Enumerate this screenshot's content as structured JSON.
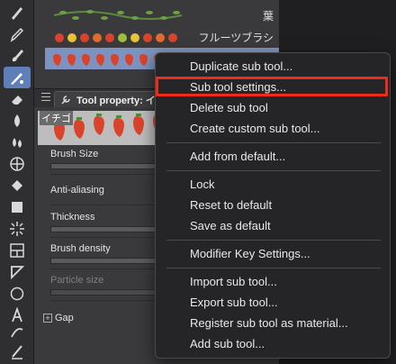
{
  "toolbar": {
    "tools": [
      {
        "icon": "pen-icon"
      },
      {
        "icon": "pencil-icon"
      },
      {
        "icon": "brush-icon"
      },
      {
        "icon": "decoration-icon",
        "active": true
      },
      {
        "icon": "eraser-icon"
      },
      {
        "icon": "blend-icon"
      },
      {
        "icon": "drops-icon"
      },
      {
        "icon": "grid-icon"
      },
      {
        "icon": "fill-icon"
      },
      {
        "icon": "gradient-icon"
      },
      {
        "icon": "burst-icon"
      },
      {
        "icon": "frame-icon"
      },
      {
        "icon": "ruler-icon"
      },
      {
        "icon": "circle-icon"
      },
      {
        "icon": "text-icon"
      },
      {
        "icon": "balloon-icon"
      },
      {
        "icon": "correction-icon"
      }
    ]
  },
  "subtool_list": {
    "items": [
      {
        "name": "葉"
      },
      {
        "name": "フルーツブラシ"
      },
      {
        "name": "",
        "selected": true
      }
    ]
  },
  "tool_property": {
    "tab_title": "Tool property: イ",
    "preview_label": "イチゴ",
    "properties": [
      {
        "label": "Brush Size",
        "dim": false
      },
      {
        "label": "Anti-aliasing",
        "dim": false
      },
      {
        "label": "Thickness",
        "dim": false
      },
      {
        "label": "Brush density",
        "dim": false
      },
      {
        "label": "Particle size",
        "dim": true
      }
    ],
    "gap": {
      "toggle": "+",
      "label": "Gap"
    }
  },
  "context_menu": {
    "items": [
      "Duplicate sub tool...",
      "Sub tool settings...",
      "Delete sub tool",
      "Create custom sub tool...",
      "Add from default...",
      "Lock",
      "Reset to default",
      "Save as default",
      "Modifier Key Settings...",
      "Import sub tool...",
      "Export sub tool...",
      "Register sub tool as material...",
      "Add sub tool..."
    ],
    "highlighted": "Sub tool settings...",
    "highlight_color": "#ef2b18"
  },
  "colors": {
    "active_tool": "#5f7fb8",
    "selected_row": "#7d93bf",
    "strawberry": "#d9432b"
  }
}
